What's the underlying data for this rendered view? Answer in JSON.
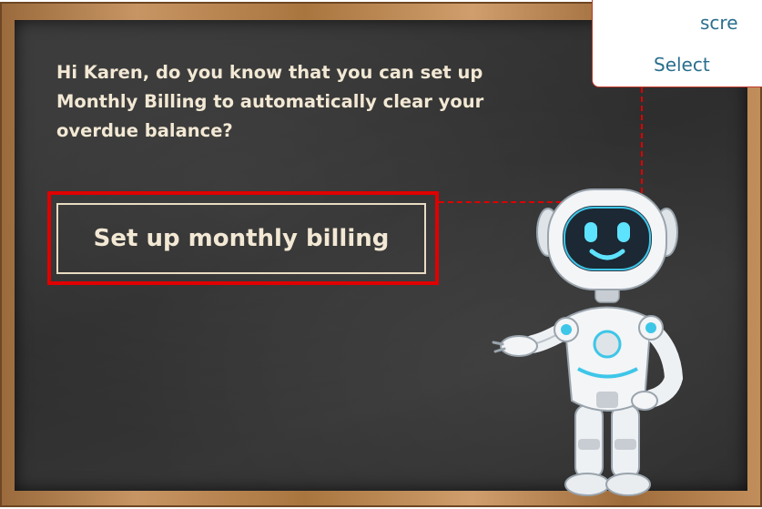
{
  "board": {
    "message": "Hi Karen, do you know that you can set up Monthly Billing to automatically clear your overdue balance?",
    "cta_label": "Set up monthly billing"
  },
  "callout": {
    "line1": "scre",
    "line2": "Select"
  },
  "colors": {
    "chalkboard": "#2f2f2f",
    "chalk_text": "#f2e8d4",
    "highlight_red": "#e00000",
    "callout_text": "#2a6f8e",
    "robot_accent": "#3ec6e8"
  },
  "icons": {
    "robot": "robot-mascot-icon"
  }
}
